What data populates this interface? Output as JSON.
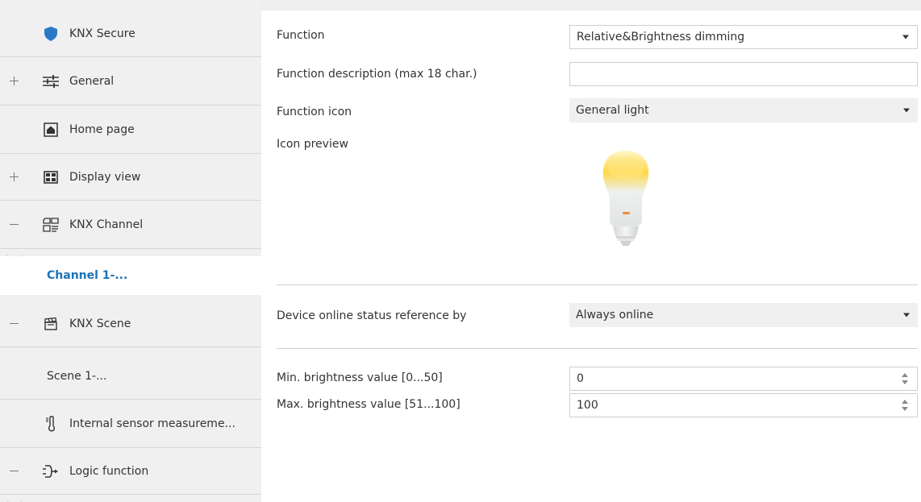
{
  "sidebar": {
    "items": [
      {
        "label": "KNX Secure",
        "icon": "shield-icon",
        "expander": "none"
      },
      {
        "label": "General",
        "icon": "sliders-icon",
        "expander": "plus"
      },
      {
        "label": "Home page",
        "icon": "home-icon",
        "expander": "none"
      },
      {
        "label": "Display view",
        "icon": "grid-icon",
        "expander": "plus"
      },
      {
        "label": "KNX Channel",
        "icon": "channel-icon",
        "expander": "minus"
      },
      {
        "label": "Channel 1-...",
        "active": true
      },
      {
        "label": "KNX Scene",
        "icon": "scene-clapper-icon",
        "expander": "minus"
      },
      {
        "label": "Scene 1-..."
      },
      {
        "label": "Internal sensor measureme...",
        "icon": "thermometer-icon",
        "expander": "none"
      },
      {
        "label": "Logic function",
        "icon": "logic-icon",
        "expander": "minus"
      }
    ]
  },
  "main": {
    "function": {
      "label": "Function",
      "value": "Relative&Brightness dimming"
    },
    "function_description": {
      "label": "Function description (max 18 char.)",
      "value": ""
    },
    "function_icon": {
      "label": "Function icon",
      "value": "General light"
    },
    "icon_preview": {
      "label": "Icon preview",
      "icon": "light-bulb-icon"
    },
    "online_status": {
      "label": "Device online status reference by",
      "value": "Always online"
    },
    "min_brightness": {
      "label": "Min. brightness value [0...50]",
      "value": "0",
      "unit": "%"
    },
    "max_brightness": {
      "label": "Max. brightness value [51...100]",
      "value": "100",
      "unit": "%"
    }
  },
  "colors": {
    "accent": "#1a73b8",
    "shield": "#2b78c5",
    "sidebar_bg": "#f0f0f0"
  }
}
